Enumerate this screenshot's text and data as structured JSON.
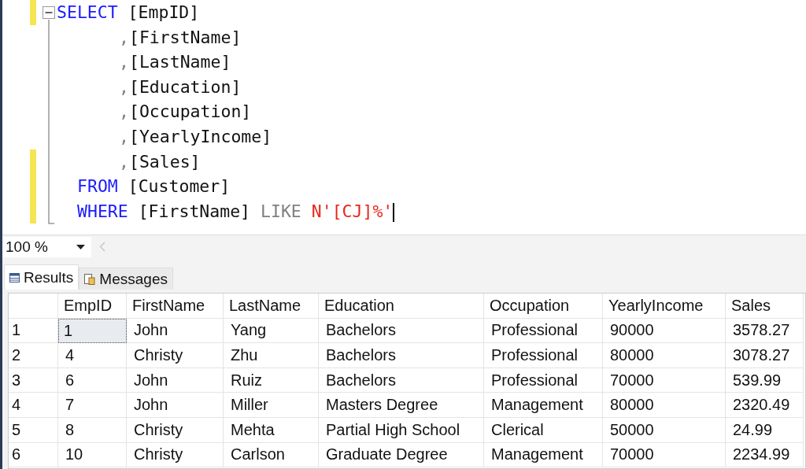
{
  "editor": {
    "lines": [
      {
        "kind": "select",
        "changed": true,
        "tokens": [
          {
            "kind": "keyword",
            "text": "SELECT"
          },
          {
            "kind": "plain",
            "text": " [EmpID]"
          }
        ]
      },
      {
        "kind": "column",
        "changed": false,
        "tokens": [
          {
            "kind": "operator",
            "text": ","
          },
          {
            "kind": "plain",
            "text": "[FirstName]"
          }
        ]
      },
      {
        "kind": "column",
        "changed": false,
        "tokens": [
          {
            "kind": "operator",
            "text": ","
          },
          {
            "kind": "plain",
            "text": "[LastName]"
          }
        ]
      },
      {
        "kind": "column",
        "changed": false,
        "tokens": [
          {
            "kind": "operator",
            "text": ","
          },
          {
            "kind": "plain",
            "text": "[Education]"
          }
        ]
      },
      {
        "kind": "column",
        "changed": false,
        "tokens": [
          {
            "kind": "operator",
            "text": ","
          },
          {
            "kind": "plain",
            "text": "[Occupation]"
          }
        ]
      },
      {
        "kind": "column",
        "changed": false,
        "tokens": [
          {
            "kind": "operator",
            "text": ","
          },
          {
            "kind": "plain",
            "text": "[YearlyIncome]"
          }
        ]
      },
      {
        "kind": "column",
        "changed": true,
        "tokens": [
          {
            "kind": "operator",
            "text": ","
          },
          {
            "kind": "plain",
            "text": "[Sales]"
          }
        ]
      },
      {
        "kind": "clause",
        "changed": true,
        "tokens": [
          {
            "kind": "keyword",
            "text": "FROM"
          },
          {
            "kind": "plain",
            "text": " [Customer]"
          }
        ]
      },
      {
        "kind": "clause",
        "changed": true,
        "tokens": [
          {
            "kind": "keyword",
            "text": "WHERE"
          },
          {
            "kind": "plain",
            "text": " [FirstName] "
          },
          {
            "kind": "operator",
            "text": "LIKE"
          },
          {
            "kind": "string",
            "text": " N'[CJ]%'"
          }
        ]
      }
    ]
  },
  "zoom": {
    "value": "100 %"
  },
  "tabs": [
    {
      "label": "Results",
      "kind": "grid",
      "selected": true
    },
    {
      "label": "Messages",
      "kind": "messages",
      "selected": false
    }
  ],
  "table": {
    "columns": [
      "EmpID",
      "FirstName",
      "LastName",
      "Education",
      "Occupation",
      "YearlyIncome",
      "Sales"
    ],
    "rows": [
      {
        "number": "1",
        "selected": true,
        "cells": [
          "1",
          "John",
          "Yang",
          "Bachelors",
          "Professional",
          "90000",
          "3578.27"
        ]
      },
      {
        "number": "2",
        "selected": false,
        "cells": [
          "4",
          "Christy",
          "Zhu",
          "Bachelors",
          "Professional",
          "80000",
          "3078.27"
        ]
      },
      {
        "number": "3",
        "selected": false,
        "cells": [
          "6",
          "John",
          "Ruiz",
          "Bachelors",
          "Professional",
          "70000",
          "539.99"
        ]
      },
      {
        "number": "4",
        "selected": false,
        "cells": [
          "7",
          "John",
          "Miller",
          "Masters Degree",
          "Management",
          "80000",
          "2320.49"
        ]
      },
      {
        "number": "5",
        "selected": false,
        "cells": [
          "8",
          "Christy",
          "Mehta",
          "Partial High School",
          "Clerical",
          "50000",
          "24.99"
        ]
      },
      {
        "number": "6",
        "selected": false,
        "cells": [
          "10",
          "Christy",
          "Carlson",
          "Graduate Degree",
          "Management",
          "70000",
          "2234.99"
        ]
      }
    ]
  }
}
